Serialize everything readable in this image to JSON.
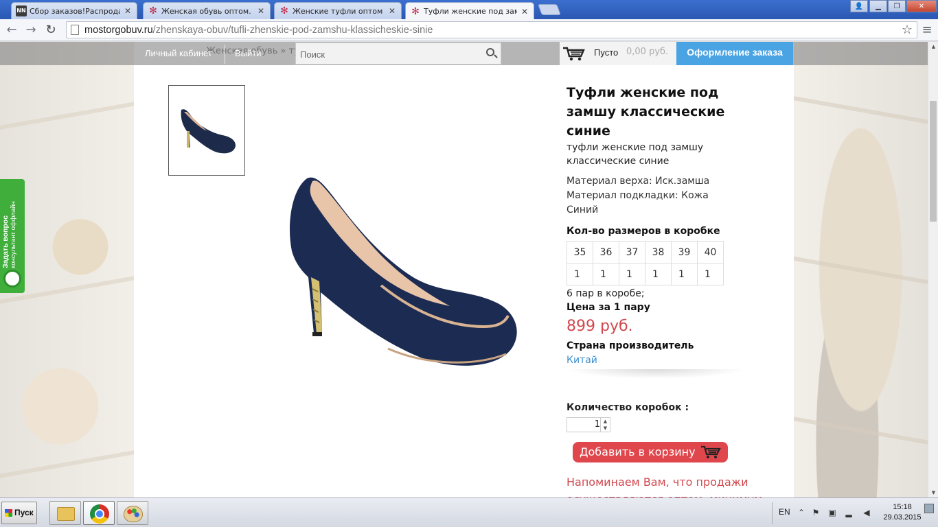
{
  "browser": {
    "tabs": [
      {
        "title": "Сбор заказов!Распродажа д",
        "favicon": "nn-icon",
        "favicon_text": "NN"
      },
      {
        "title": "Женская обувь оптом. Куп",
        "favicon": "star-icon"
      },
      {
        "title": "Женские туфли оптом | Ве",
        "favicon": "star-icon"
      },
      {
        "title": "Туфли женские под замшу",
        "favicon": "star-icon",
        "active": true
      }
    ],
    "url_host": "mostorgobuv.ru",
    "url_path": "/zhenskaya-obuv/tufli-zhenskie-pod-zamshu-klassicheskie-sinie"
  },
  "header": {
    "breadcrumb_ghost": "Женская обувь » туфли женские под замшу классические",
    "account_label": "Личный кабинет",
    "logout_label": "Выйти",
    "search_placeholder": "Поиск",
    "cart_empty": "Пусто",
    "cart_sum": "0,00 руб.",
    "checkout_label": "Оформление заказа"
  },
  "side_widget": {
    "title": "Задать вопрос",
    "subtitle": "консультант оффлайн"
  },
  "product": {
    "title": "Туфли женские под замшу классические синие",
    "subtitle": "туфли женские под замшу классические синие",
    "attributes": [
      "Материал верха: Иск.замша",
      "Материал подкладки: Кожа",
      "Синий"
    ],
    "sizes_heading": "Кол-во размеров в коробке",
    "sizes": [
      "35",
      "36",
      "37",
      "38",
      "39",
      "40"
    ],
    "counts": [
      "1",
      "1",
      "1",
      "1",
      "1",
      "1"
    ],
    "pairs_in_box": "6 пар в коробе;",
    "price_heading": "Цена за 1 пару",
    "price": "899 руб.",
    "country_heading": "Страна производитель",
    "country": "Китай",
    "quantity_label": "Количество коробок :",
    "quantity_value": "1",
    "add_to_cart": "Добавить в корзину",
    "notice": "Напоминаем Вам, что продажи осуществляются оптом, минимум один короб."
  },
  "taskbar": {
    "start_label": "Пуск",
    "lang": "EN",
    "time": "15:18",
    "date": "29.03.2015"
  },
  "colors": {
    "accent_blue": "#4aa3e3",
    "price_red": "#d0484d",
    "widget_green": "#3fae3a",
    "link_blue": "#3b8fd0"
  }
}
